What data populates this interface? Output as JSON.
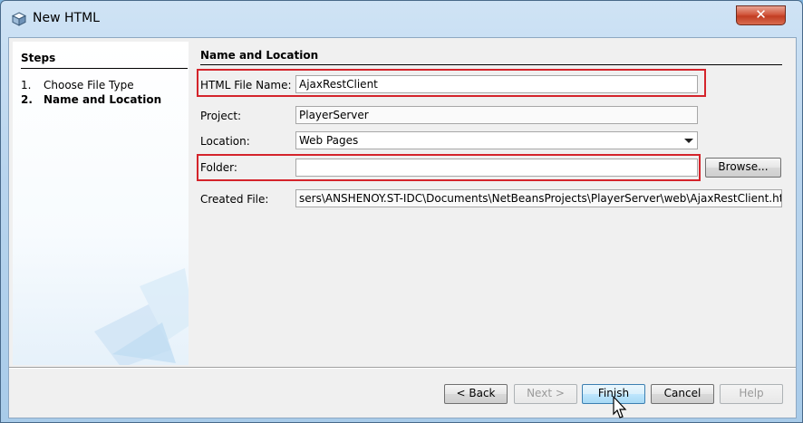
{
  "window": {
    "title": "New HTML",
    "close_label": "✕"
  },
  "steps": {
    "title": "Steps",
    "items": [
      {
        "num": "1.",
        "label": "Choose File Type"
      },
      {
        "num": "2.",
        "label": "Name and Location"
      }
    ]
  },
  "panel": {
    "title": "Name and Location",
    "html_file_name_label": "HTML File Name:",
    "html_file_name_value": "AjaxRestClient",
    "project_label": "Project:",
    "project_value": "PlayerServer",
    "location_label": "Location:",
    "location_value": "Web Pages",
    "folder_label": "Folder:",
    "folder_value": "",
    "browse_label": "Browse...",
    "created_file_label": "Created File:",
    "created_file_value": "sers\\ANSHENOY.ST-IDC\\Documents\\NetBeansProjects\\PlayerServer\\web\\AjaxRestClient.html"
  },
  "buttons": {
    "back": "< Back",
    "next": "Next >",
    "finish": "Finish",
    "cancel": "Cancel",
    "help": "Help"
  },
  "colors": {
    "highlight": "#d4242b",
    "title_bar": "#b9d5ee",
    "close_button": "#c23d22"
  }
}
